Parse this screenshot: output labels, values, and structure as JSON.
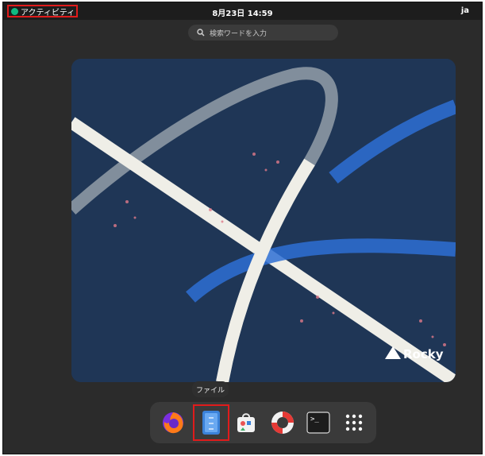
{
  "topbar": {
    "activities_label": "アクティビティ",
    "clock": "8月23日 14:59",
    "lang": "ja"
  },
  "search": {
    "placeholder": "検索ワードを入力",
    "icon": "search-icon"
  },
  "workspace": {
    "wallpaper_logo": "Rocky"
  },
  "dock": {
    "tooltip": "ファイル",
    "items": [
      {
        "name": "firefox",
        "icon": "firefox-icon"
      },
      {
        "name": "files",
        "icon": "files-icon"
      },
      {
        "name": "software",
        "icon": "software-icon"
      },
      {
        "name": "help",
        "icon": "help-icon"
      },
      {
        "name": "terminal",
        "icon": "terminal-icon"
      },
      {
        "name": "app-grid",
        "icon": "app-grid-icon"
      }
    ]
  },
  "colors": {
    "accent_highlight": "#e01b1b",
    "topbar_bg": "#1d1d1d",
    "overview_bg": "#2b2b2b",
    "wallpaper_bg": "#1f3656"
  }
}
